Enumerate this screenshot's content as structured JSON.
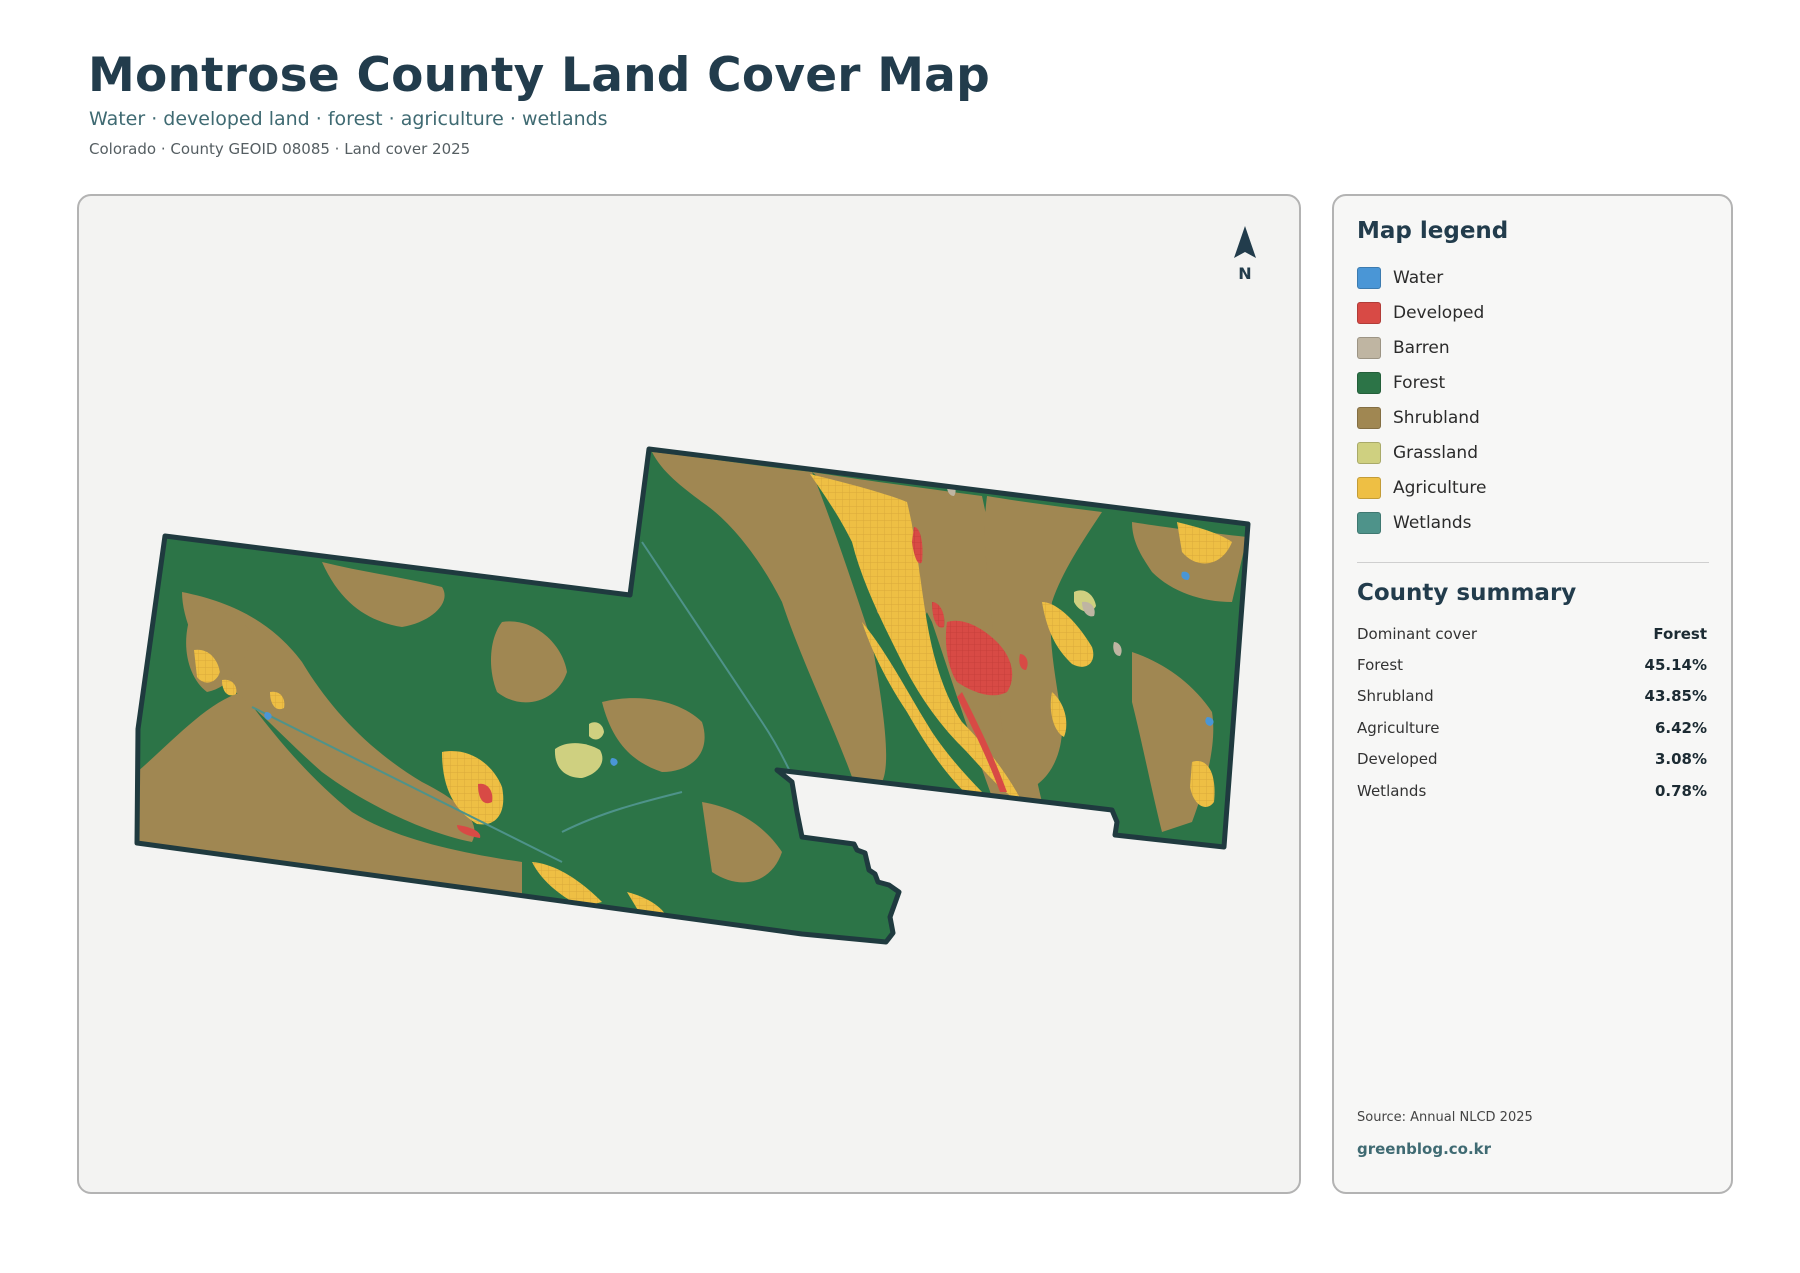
{
  "header": {
    "title": "Montrose County Land Cover Map",
    "subtitle": "Water · developed land · forest · agriculture · wetlands",
    "meta": "Colorado · County GEOID 08085 · Land cover 2025"
  },
  "map": {
    "north_label": "N",
    "colors": {
      "water": "#4a96d6",
      "developed": "#d84a45",
      "barren": "#bfb5a2",
      "forest": "#2c7447",
      "shrubland": "#a08752",
      "grassland": "#cfd080",
      "agriculture": "#eebf44",
      "wetlands": "#4e938a",
      "outline": "#1f3a3f",
      "background": "#f3f3f2"
    }
  },
  "legend": {
    "title": "Map legend",
    "items": [
      {
        "label": "Water",
        "color": "#4a96d6",
        "icon": "water-swatch"
      },
      {
        "label": "Developed",
        "color": "#d84a45",
        "icon": "developed-swatch"
      },
      {
        "label": "Barren",
        "color": "#bfb5a2",
        "icon": "barren-swatch"
      },
      {
        "label": "Forest",
        "color": "#2c7447",
        "icon": "forest-swatch"
      },
      {
        "label": "Shrubland",
        "color": "#a08752",
        "icon": "shrubland-swatch"
      },
      {
        "label": "Grassland",
        "color": "#cfd080",
        "icon": "grassland-swatch"
      },
      {
        "label": "Agriculture",
        "color": "#eebf44",
        "icon": "agriculture-swatch"
      },
      {
        "label": "Wetlands",
        "color": "#4e938a",
        "icon": "wetlands-swatch"
      }
    ]
  },
  "summary": {
    "title": "County summary",
    "rows": [
      {
        "label": "Dominant cover",
        "value": "Forest"
      },
      {
        "label": "Forest",
        "value": "45.14%"
      },
      {
        "label": "Shrubland",
        "value": "43.85%"
      },
      {
        "label": "Agriculture",
        "value": "6.42%"
      },
      {
        "label": "Developed",
        "value": "3.08%"
      },
      {
        "label": "Wetlands",
        "value": "0.78%"
      }
    ]
  },
  "footer": {
    "source": "Source: Annual NLCD 2025",
    "site": "greenblog.co.kr"
  }
}
